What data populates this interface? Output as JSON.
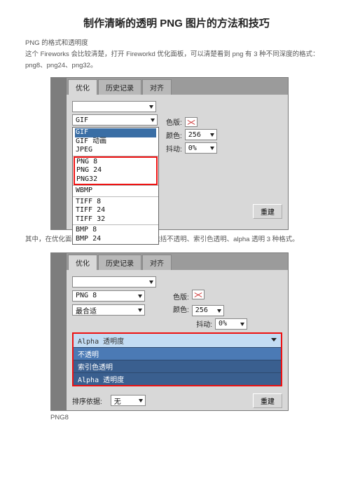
{
  "title": "制作清晰的透明 PNG 图片的方法和技巧",
  "subhead": "PNG 的格式和透明度",
  "para1": "这个 Fireworks 会比较清楚，打开 Fireworkd 优化面板，可以清楚看到 png 有 3 种不同深度的格式：png8、png24、png32。",
  "caption1": "其中，在优化面板选择 png8，可发现 png8 包括不透明、索引色透明、alpha 透明 3 种格式。",
  "footer": "PNG8",
  "tabs": {
    "t1": "优化",
    "t2": "历史记录",
    "t3": "对齐"
  },
  "panel1": {
    "format_selected": "GIF",
    "format_list": [
      "GIF",
      "GIF 动画",
      "JPEG",
      "PNG 8",
      "PNG 24",
      "PNG32",
      "WBMP",
      "TIFF 8",
      "TIFF 24",
      "TIFF 32",
      "BMP 8",
      "BMP 24"
    ],
    "lbl_palette": "色版:",
    "lbl_colors": "颜色:",
    "val_colors": "256",
    "lbl_dither": "抖动:",
    "val_dither": "0%",
    "btn_rebuild": "重建"
  },
  "panel2": {
    "format": "PNG 8",
    "fit": "最合适",
    "lbl_palette": "色版:",
    "lbl_colors": "颜色:",
    "val_colors": "256",
    "lbl_dither": "抖动:",
    "val_dither": "0%",
    "alpha_head": "Alpha 透明度",
    "alpha_opts": [
      "不透明",
      "索引色透明",
      "Alpha 透明度"
    ],
    "lbl_sort": "排序依据:",
    "val_sort": "无",
    "btn_rebuild": "重建"
  }
}
